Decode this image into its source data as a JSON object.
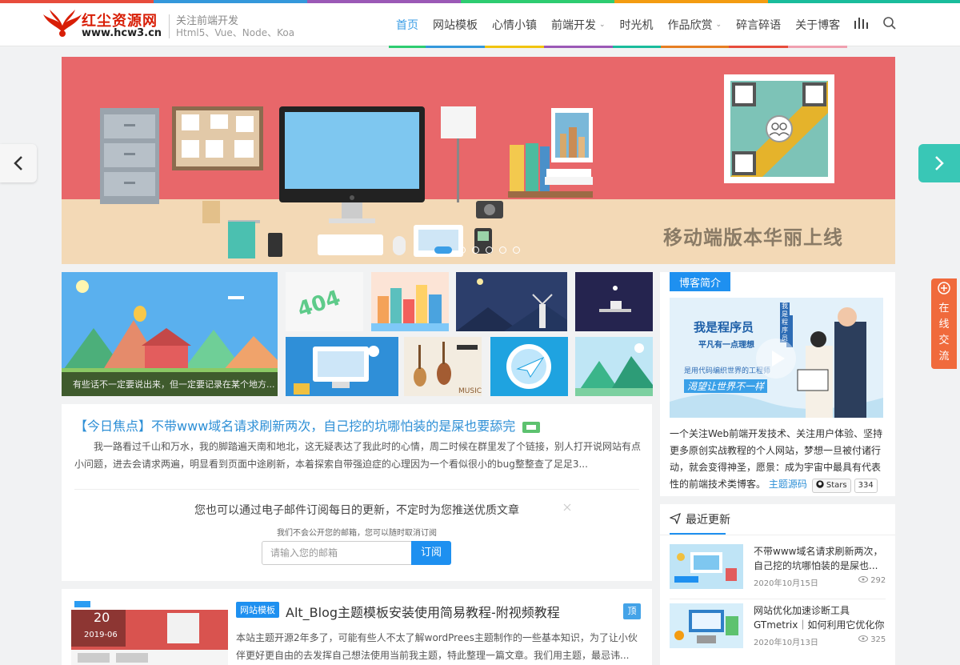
{
  "header": {
    "logo_cn": "红尘资源网",
    "logo_en": "www.hcw3.cn",
    "tagline": "关注前端开发",
    "tagline_sub": "Html5、Vue、Node、Koa",
    "nav": [
      {
        "label": "首页",
        "active": true,
        "color": "#2ecc71"
      },
      {
        "label": "网站模板",
        "color": "#3498db"
      },
      {
        "label": "心情小镇",
        "color": "#f1c40f"
      },
      {
        "label": "前端开发",
        "caret": true,
        "color": "#9b59b6"
      },
      {
        "label": "时光机",
        "color": "#1abc9c"
      },
      {
        "label": "作品欣赏",
        "caret": true,
        "color": "#e67e22"
      },
      {
        "label": "碎言碎语",
        "color": "#e74c3c"
      },
      {
        "label": "关于博客",
        "color": "#95a5a6"
      }
    ],
    "icons": [
      "stats-icon",
      "search-icon"
    ]
  },
  "slider": {
    "caption": "移动端版本华丽上线",
    "active_index": 0,
    "count": 6
  },
  "gallery": {
    "big_caption": "有些话不一定要说出来，但一定要记录在某个地方..."
  },
  "featured": {
    "prefix": "【今日焦点】",
    "title": "不带www域名请求刷新两次，自己挖的坑哪怕装的是屎也要舔完",
    "body": "我一路看过千山和万水，我的脚踏遍天南和地北，这无疑表达了我此时的心情，周二时候在群里发了个链接，别人打开说网站有点小问题，进去会请求两遍，明显看到页面中途刷新，本着探索自带强迫症的心理因为一个看似很小的bug整整查了足足3..."
  },
  "subscribe": {
    "title": "您也可以通过电子邮件订阅每日的更新，不定时为您推送优质文章",
    "note": "我们不会公开您的邮箱，您可以随时取消订阅",
    "placeholder": "请输入您的邮箱",
    "button": "订阅"
  },
  "post": {
    "category": "网站模板",
    "title": "Alt_Blog主题模板安装使用简易教程-附视频教程",
    "excerpt": "本站主题开源2年多了，可能有些人不太了解wordPrees主题制作的一些基本知识，为了让小伙伴更好更自由的去发挥自己想法使用当前我主题，特此整理一篇文章。我们用主题，最忌讳...",
    "day": "20",
    "month": "2019-06",
    "top_label": "顶"
  },
  "sidebar": {
    "intro_title": "博客简介",
    "intro_img_title": "我是程序员",
    "intro_img_sub": "平凡有一点理想",
    "intro_img_line": "是用代码编织世界的工程师",
    "intro_img_slogan": "渴望让世界不一样",
    "intro_badge": "我是程序员",
    "intro_text": "一个关注Web前端开发技术、关注用户体验、坚持更多原创实战教程的个人网站，梦想一旦被付诸行动，就会变得神圣，愿景：成为宇宙中最具有代表性的前端技术类博客。",
    "source_link": "主题源码",
    "stars_label": "Stars",
    "stars_count": "334",
    "recent_title": "最近更新",
    "recent": [
      {
        "title": "不带www域名请求刷新两次，自己挖的坑哪怕装的是屎也...",
        "date": "2020年10月15日",
        "views": "292"
      },
      {
        "title": "网站优化加速诊断工具GTmetrix｜如何利用它优化你的网站",
        "date": "2020年10月13日",
        "views": "325"
      }
    ]
  },
  "online": {
    "label": "在线交流"
  },
  "colors": {
    "accent": "#1e90f0",
    "slider_bg": "#e8676a",
    "online_bg": "#f06a3c"
  }
}
